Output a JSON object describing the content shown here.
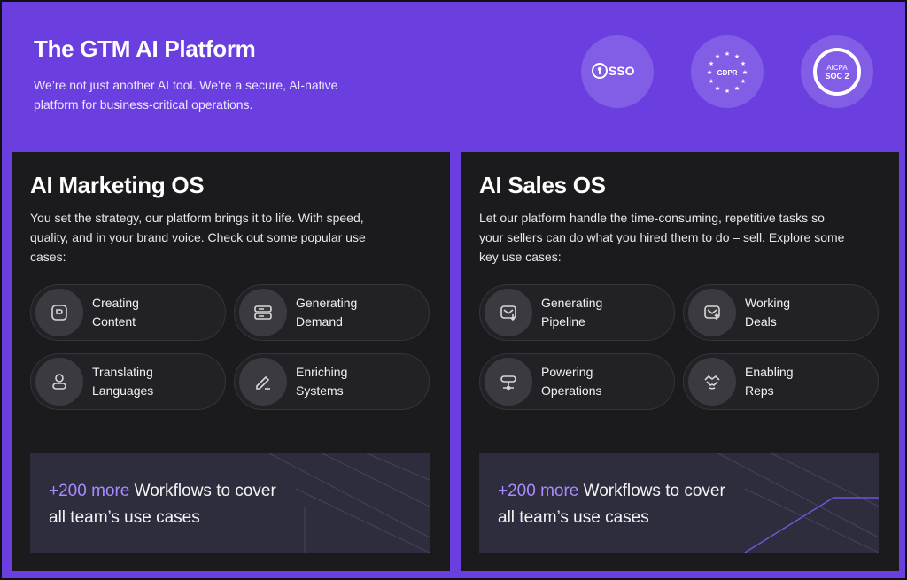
{
  "hero": {
    "title": "The GTM AI Platform",
    "subtitle": "We’re not just another AI tool. We’re a secure, AI-native platform for business-critical operations."
  },
  "badges": [
    {
      "name": "SSO",
      "icon": "sso-badge-icon"
    },
    {
      "name": "GDPR",
      "icon": "gdpr-badge-icon"
    },
    {
      "name": "AICPA SOC 2",
      "line1": "AICPA",
      "line2": "SOC 2",
      "icon": "soc2-badge-icon"
    }
  ],
  "marketing": {
    "title": "AI Marketing OS",
    "description": "You set the strategy, our platform brings it to life. With speed, quality, and in your brand voice. Check out some popular use cases:",
    "cards": [
      {
        "line1": "Creating",
        "line2": "Content",
        "icon": "content-icon"
      },
      {
        "line1": "Generating",
        "line2": "Demand",
        "icon": "demand-icon"
      },
      {
        "line1": "Translating",
        "line2": "Languages",
        "icon": "user-icon"
      },
      {
        "line1": "Enriching",
        "line2": "Systems",
        "icon": "pencil-icon"
      }
    ],
    "promo": {
      "accent": "+200 more",
      "rest": " Workflows to cover",
      "line2": "all team’s use cases"
    }
  },
  "sales": {
    "title": "AI Sales OS",
    "description": "Let our platform handle the time-consuming, repetitive tasks so your sellers can do what you hired them to do – sell. Explore some key use cases:",
    "cards": [
      {
        "line1": "Generating",
        "line2": "Pipeline",
        "icon": "mail-down-icon"
      },
      {
        "line1": "Working",
        "line2": "Deals",
        "icon": "mail-up-icon"
      },
      {
        "line1": "Powering",
        "line2": "Operations",
        "icon": "network-icon"
      },
      {
        "line1": "Enabling",
        "line2": "Reps",
        "icon": "handshake-icon"
      }
    ],
    "promo": {
      "accent": "+200 more",
      "rest": " Workflows to cover",
      "line2": "all team’s use cases"
    }
  },
  "colors": {
    "brand": "#6b3ee0",
    "panel": "#1b1b1d",
    "accent": "#a98bff"
  }
}
